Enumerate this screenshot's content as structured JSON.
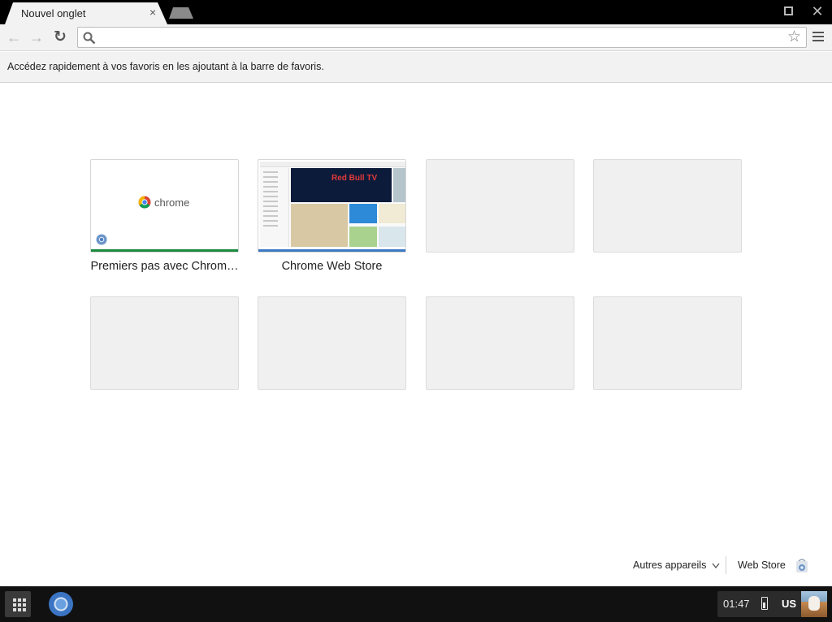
{
  "tab": {
    "title": "Nouvel onglet",
    "close_glyph": "×"
  },
  "window_controls": {
    "maximize": "□",
    "close": "✕"
  },
  "toolbar": {
    "back_glyph": "←",
    "forward_glyph": "→",
    "reload_glyph": "↻",
    "omnibox_value": "",
    "star_glyph": "☆"
  },
  "bookmark_bar": {
    "hint": "Accédez rapidement à vos favoris en les ajoutant à la barre de favoris."
  },
  "most_visited": [
    {
      "title": "Premiers pas avec Chrom…",
      "thumb": "chrome-welcome",
      "logo_text": "chrome",
      "accent": "#1b8a3e"
    },
    {
      "title": "Chrome Web Store",
      "thumb": "web-store",
      "banner_text": "Red Bull TV",
      "accent": "#3d78c4"
    },
    {
      "title": "",
      "thumb": "empty"
    },
    {
      "title": "",
      "thumb": "empty"
    },
    {
      "title": "",
      "thumb": "empty"
    },
    {
      "title": "",
      "thumb": "empty"
    },
    {
      "title": "",
      "thumb": "empty"
    },
    {
      "title": "",
      "thumb": "empty"
    }
  ],
  "footer": {
    "other_devices": "Autres appareils",
    "web_store": "Web Store"
  },
  "shelf": {
    "time": "01:47",
    "ime": "US"
  },
  "colors": {
    "tab_bg": "#f2f2f2",
    "toolbar_bg": "#f2f2f2",
    "tile_empty": "#f0f0f0",
    "shelf_bg": "#111111"
  }
}
